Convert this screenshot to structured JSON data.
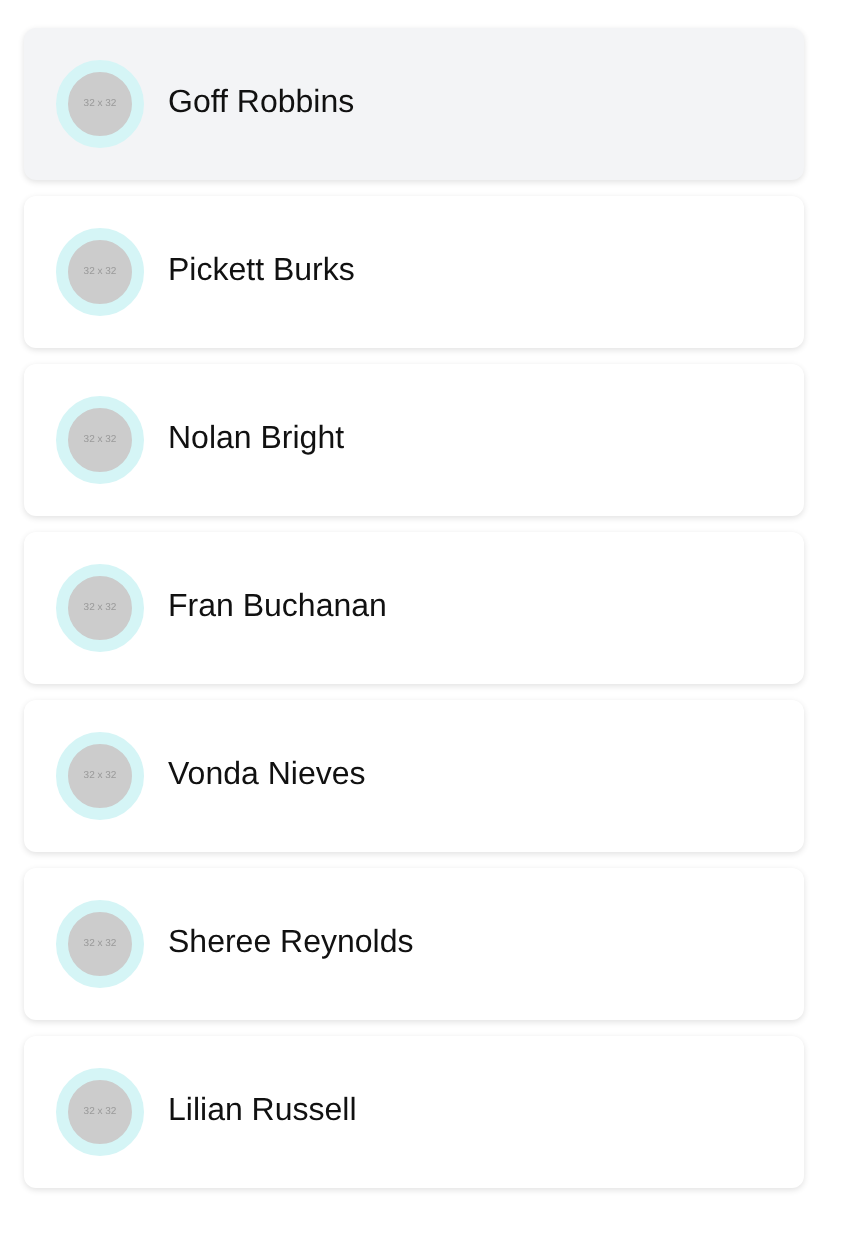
{
  "contacts": [
    {
      "name": "Goff Robbins",
      "avatar_text": "32 x 32",
      "selected": true
    },
    {
      "name": "Pickett Burks",
      "avatar_text": "32 x 32",
      "selected": false
    },
    {
      "name": "Nolan Bright",
      "avatar_text": "32 x 32",
      "selected": false
    },
    {
      "name": "Fran Buchanan",
      "avatar_text": "32 x 32",
      "selected": false
    },
    {
      "name": "Vonda Nieves",
      "avatar_text": "32 x 32",
      "selected": false
    },
    {
      "name": "Sheree Reynolds",
      "avatar_text": "32 x 32",
      "selected": false
    },
    {
      "name": "Lilian Russell",
      "avatar_text": "32 x 32",
      "selected": false
    }
  ]
}
